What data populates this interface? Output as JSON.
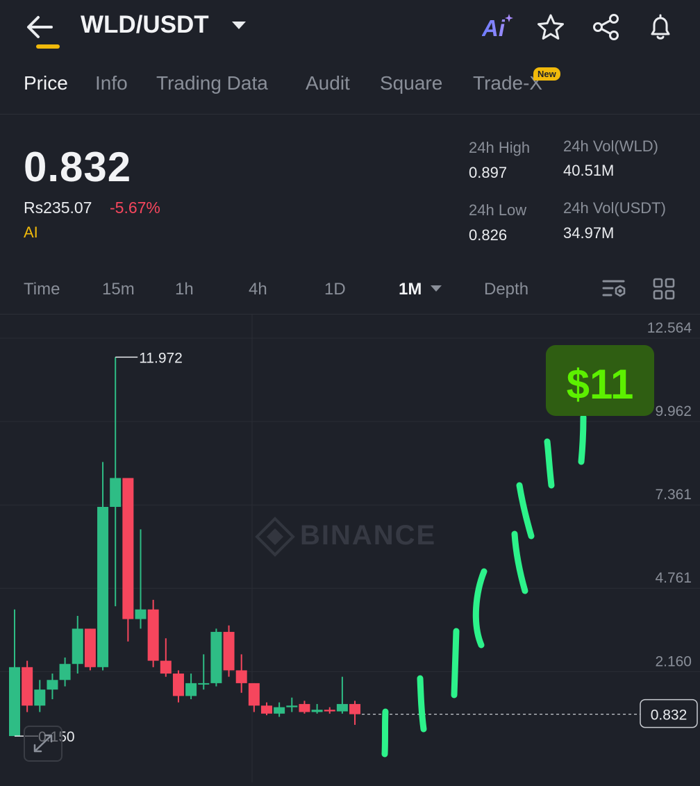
{
  "header": {
    "pair": "WLD/USDT",
    "ai_label": "Ai",
    "icons": [
      "back-arrow-icon",
      "ai-icon",
      "star-icon",
      "share-icon",
      "bell-icon"
    ]
  },
  "tabs": [
    {
      "label": "Price",
      "active": true
    },
    {
      "label": "Info"
    },
    {
      "label": "Trading Data"
    },
    {
      "label": "Audit"
    },
    {
      "label": "Square"
    },
    {
      "label": "Trade-X",
      "badge": "New"
    }
  ],
  "ticker": {
    "price": "0.832",
    "fiat": "Rs235.07",
    "change": "-5.67%",
    "ai_tag": "AI",
    "high_label": "24h High",
    "high_value": "0.897",
    "low_label": "24h Low",
    "low_value": "0.826",
    "vol_base_label": "24h Vol(WLD)",
    "vol_base_value": "40.51M",
    "vol_quote_label": "24h Vol(USDT)",
    "vol_quote_value": "34.97M"
  },
  "timeframes": [
    {
      "label": "Time"
    },
    {
      "label": "15m"
    },
    {
      "label": "1h"
    },
    {
      "label": "4h"
    },
    {
      "label": "1D"
    },
    {
      "label": "1M",
      "active": true
    },
    {
      "label": "Depth"
    }
  ],
  "colors": {
    "up": "#2ebd85",
    "down": "#f6465d",
    "accent": "#f0b90b",
    "annotation": "#2df28a",
    "target_bg": "#2f5e12",
    "target_text": "#5cf000"
  },
  "chart_data": {
    "type": "candlestick",
    "y_axis_labels": [
      "12.564",
      "9.962",
      "7.361",
      "4.761",
      "2.160"
    ],
    "ylim": [
      0,
      12.564
    ],
    "high_marker": "11.972",
    "low_marker": "0.150",
    "current_price": "0.832",
    "watermark": "BINANCE",
    "target_label": "$11",
    "candles": [
      {
        "o": 0.15,
        "h": 4.1,
        "l": 0.15,
        "c": 2.3
      },
      {
        "o": 2.3,
        "h": 2.5,
        "l": 0.9,
        "c": 1.1
      },
      {
        "o": 1.1,
        "h": 1.9,
        "l": 0.9,
        "c": 1.6
      },
      {
        "o": 1.6,
        "h": 2.1,
        "l": 1.3,
        "c": 1.9
      },
      {
        "o": 1.9,
        "h": 2.6,
        "l": 1.7,
        "c": 2.4
      },
      {
        "o": 2.4,
        "h": 3.9,
        "l": 2.1,
        "c": 3.5
      },
      {
        "o": 3.5,
        "h": 3.5,
        "l": 2.2,
        "c": 2.3
      },
      {
        "o": 2.3,
        "h": 8.7,
        "l": 2.2,
        "c": 7.3
      },
      {
        "o": 7.3,
        "h": 11.972,
        "l": 4.2,
        "c": 8.2
      },
      {
        "o": 8.2,
        "h": 8.2,
        "l": 3.1,
        "c": 3.8
      },
      {
        "o": 3.8,
        "h": 6.6,
        "l": 3.5,
        "c": 4.1
      },
      {
        "o": 4.1,
        "h": 4.4,
        "l": 2.3,
        "c": 2.5
      },
      {
        "o": 2.5,
        "h": 3.2,
        "l": 2.0,
        "c": 2.1
      },
      {
        "o": 2.1,
        "h": 2.2,
        "l": 1.2,
        "c": 1.4
      },
      {
        "o": 1.4,
        "h": 2.1,
        "l": 1.3,
        "c": 1.8
      },
      {
        "o": 1.8,
        "h": 2.7,
        "l": 1.6,
        "c": 1.8
      },
      {
        "o": 1.8,
        "h": 3.5,
        "l": 1.7,
        "c": 3.4
      },
      {
        "o": 3.4,
        "h": 3.6,
        "l": 2.0,
        "c": 2.2
      },
      {
        "o": 2.2,
        "h": 2.7,
        "l": 1.5,
        "c": 1.8
      },
      {
        "o": 1.8,
        "h": 1.8,
        "l": 0.9,
        "c": 1.1
      },
      {
        "o": 1.1,
        "h": 1.2,
        "l": 0.8,
        "c": 0.85
      },
      {
        "o": 0.85,
        "h": 1.2,
        "l": 0.75,
        "c": 1.05
      },
      {
        "o": 1.05,
        "h": 1.35,
        "l": 0.9,
        "c": 1.1
      },
      {
        "o": 1.15,
        "h": 1.25,
        "l": 0.85,
        "c": 0.9
      },
      {
        "o": 0.9,
        "h": 1.15,
        "l": 0.85,
        "c": 0.97
      },
      {
        "o": 0.97,
        "h": 1.05,
        "l": 0.85,
        "c": 0.92
      },
      {
        "o": 0.92,
        "h": 2.0,
        "l": 0.85,
        "c": 1.15
      },
      {
        "o": 1.15,
        "h": 1.25,
        "l": 0.5,
        "c": 0.832
      }
    ]
  }
}
